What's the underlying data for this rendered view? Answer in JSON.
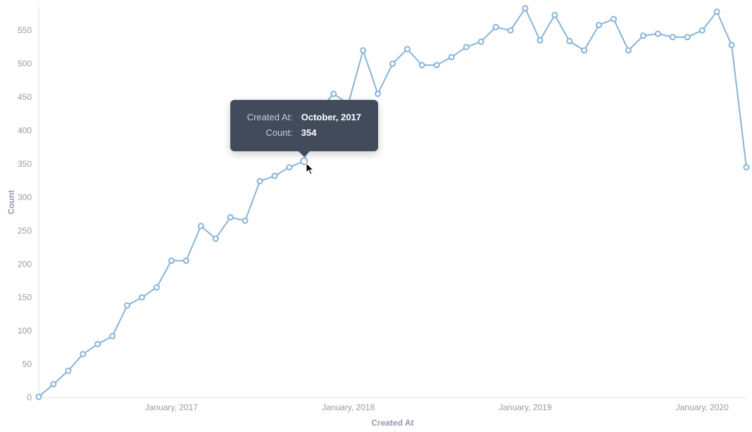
{
  "chart_data": {
    "type": "line",
    "xlabel": "Created At",
    "ylabel": "Count",
    "ylim": [
      0,
      585
    ],
    "y_ticks": [
      0,
      50,
      100,
      150,
      200,
      250,
      300,
      350,
      400,
      450,
      500,
      550
    ],
    "x_tick_labels": [
      "January, 2017",
      "January, 2018",
      "January, 2019",
      "January, 2020"
    ],
    "x": [
      "April, 2016",
      "May, 2016",
      "June, 2016",
      "July, 2016",
      "August, 2016",
      "September, 2016",
      "October, 2016",
      "November, 2016",
      "December, 2016",
      "January, 2017",
      "February, 2017",
      "March, 2017",
      "April, 2017",
      "May, 2017",
      "June, 2017",
      "July, 2017",
      "August, 2017",
      "September, 2017",
      "October, 2017",
      "November, 2017",
      "December, 2017",
      "January, 2018",
      "February, 2018",
      "March, 2018",
      "April, 2018",
      "May, 2018",
      "June, 2018",
      "July, 2018",
      "August, 2018",
      "September, 2018",
      "October, 2018",
      "November, 2018",
      "December, 2018",
      "January, 2019",
      "February, 2019",
      "March, 2019",
      "April, 2019",
      "May, 2019",
      "June, 2019",
      "July, 2019",
      "August, 2019",
      "September, 2019",
      "October, 2019",
      "November, 2019",
      "December, 2019",
      "January, 2020",
      "February, 2020",
      "March, 2020",
      "April, 2020"
    ],
    "series": [
      {
        "name": "Count",
        "values": [
          1,
          20,
          40,
          65,
          80,
          92,
          138,
          150,
          165,
          205,
          205,
          257,
          238,
          270,
          265,
          324,
          332,
          345,
          354,
          430,
          455,
          440,
          520,
          455,
          500,
          522,
          498,
          498,
          510,
          525,
          533,
          555,
          550,
          583,
          535,
          573,
          534,
          520,
          558,
          567,
          520,
          542,
          545,
          540,
          540,
          550,
          578,
          528,
          345
        ]
      }
    ],
    "x_tick_positions": [
      "January, 2017",
      "January, 2018",
      "January, 2019",
      "January, 2020"
    ]
  },
  "tooltip": {
    "rows": [
      {
        "label": "Created At:",
        "value": "October, 2017"
      },
      {
        "label": "Count:",
        "value": "354"
      }
    ],
    "hover_x": "October, 2017",
    "hover_y": 354
  },
  "layout": {
    "plot_left": 55,
    "plot_right": 1060,
    "plot_top": 10,
    "plot_bottom": 565,
    "tooltip_anchor_x": 433,
    "tooltip_anchor_y": 230
  },
  "colors": {
    "line": "#88b4d8",
    "axis": "#d9dde4",
    "text": "#949aab",
    "tooltip_bg": "#414b5c"
  }
}
